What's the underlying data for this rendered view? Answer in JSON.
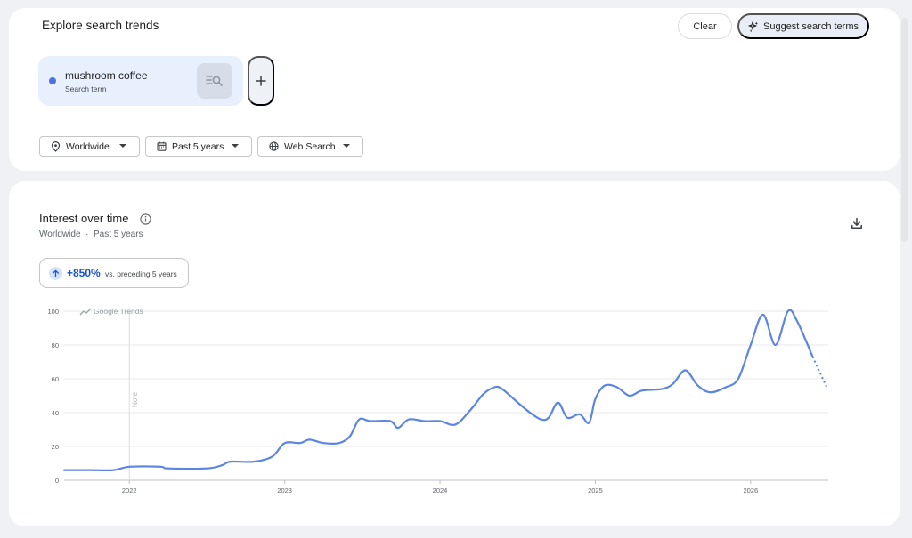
{
  "explore": {
    "title": "Explore search trends",
    "clear_label": "Clear",
    "suggest_label": "Suggest search terms"
  },
  "term": {
    "name": "mushroom coffee",
    "subtitle": "Search term",
    "color": "#4e73df"
  },
  "filters": {
    "geo": "Worldwide",
    "time": "Past 5 years",
    "property": "Web Search"
  },
  "interest": {
    "title": "Interest over time",
    "geo": "Worldwide",
    "separator": "·",
    "period": "Past 5 years",
    "change_value": "+850%",
    "change_label": "vs. preceding 5 years"
  },
  "icons": {
    "add": "plus-icon",
    "suggest": "sparkle-icon",
    "geo": "location-pin-icon",
    "time": "calendar-icon",
    "property": "globe-icon",
    "info": "info-icon",
    "download": "download-icon",
    "term": "search-list-icon"
  },
  "chart_data": {
    "type": "line",
    "watermark": "Google Trends",
    "note_label": "Note",
    "note_x": 2022.0,
    "x_ticks": [
      2022,
      2023,
      2024,
      2025,
      2026
    ],
    "xlim": [
      2021.58,
      2026.5
    ],
    "ylim": [
      0,
      100
    ],
    "y_ticks": [
      0,
      20,
      40,
      60,
      80,
      100
    ],
    "grid": true,
    "line_color": "#5b85e0",
    "series": [
      {
        "points": [
          [
            2021.58,
            6
          ],
          [
            2021.75,
            6
          ],
          [
            2021.9,
            6
          ],
          [
            2022.0,
            8
          ],
          [
            2022.2,
            8
          ],
          [
            2022.25,
            7
          ],
          [
            2022.5,
            7
          ],
          [
            2022.6,
            9
          ],
          [
            2022.65,
            11
          ],
          [
            2022.8,
            11
          ],
          [
            2022.92,
            14
          ],
          [
            2023.0,
            22
          ],
          [
            2023.1,
            22
          ],
          [
            2023.16,
            24
          ],
          [
            2023.25,
            22
          ],
          [
            2023.35,
            22
          ],
          [
            2023.42,
            26
          ],
          [
            2023.48,
            36
          ],
          [
            2023.55,
            35
          ],
          [
            2023.68,
            35
          ],
          [
            2023.73,
            31
          ],
          [
            2023.8,
            36
          ],
          [
            2023.9,
            35
          ],
          [
            2024.0,
            35
          ],
          [
            2024.1,
            33
          ],
          [
            2024.2,
            42
          ],
          [
            2024.28,
            51
          ],
          [
            2024.35,
            55
          ],
          [
            2024.4,
            54
          ],
          [
            2024.5,
            46
          ],
          [
            2024.58,
            40
          ],
          [
            2024.65,
            36
          ],
          [
            2024.7,
            37
          ],
          [
            2024.76,
            46
          ],
          [
            2024.82,
            37
          ],
          [
            2024.9,
            39
          ],
          [
            2024.96,
            34
          ],
          [
            2025.0,
            48
          ],
          [
            2025.06,
            56
          ],
          [
            2025.14,
            55
          ],
          [
            2025.22,
            50
          ],
          [
            2025.3,
            53
          ],
          [
            2025.43,
            54
          ],
          [
            2025.5,
            57
          ],
          [
            2025.58,
            65
          ],
          [
            2025.66,
            56
          ],
          [
            2025.74,
            52
          ],
          [
            2025.84,
            55
          ],
          [
            2025.92,
            60
          ],
          [
            2026.0,
            80
          ],
          [
            2026.08,
            98
          ],
          [
            2026.16,
            80
          ],
          [
            2026.24,
            100
          ],
          [
            2026.3,
            94
          ],
          [
            2026.4,
            73
          ]
        ],
        "partial_points": [
          [
            2026.4,
            73
          ],
          [
            2026.49,
            55
          ]
        ]
      }
    ]
  }
}
